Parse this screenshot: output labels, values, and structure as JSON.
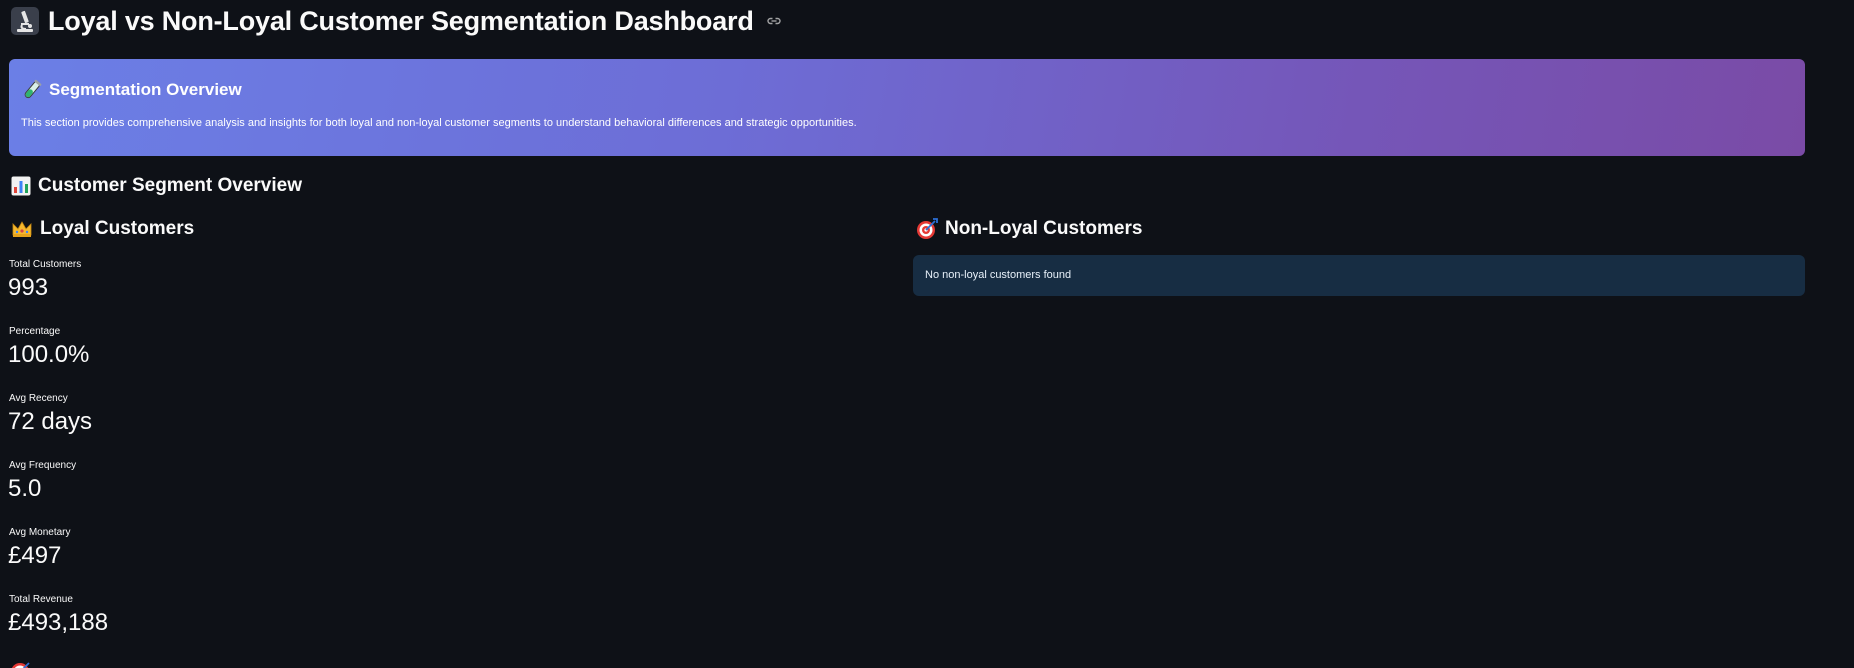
{
  "header": {
    "icon": "microscope-icon",
    "title": "Loyal vs Non-Loyal Customer Segmentation Dashboard",
    "anchor_icon": "link-icon"
  },
  "banner": {
    "icon": "test-tube-icon",
    "title": "Segmentation Overview",
    "text": "This section provides comprehensive analysis and insights for both loyal and non-loyal customer segments to understand behavioral differences and strategic opportunities.",
    "gradient_start": "#6b7fe6",
    "gradient_end": "#7a4ba6"
  },
  "overview": {
    "icon": "bar-chart-icon",
    "title": "Customer Segment Overview"
  },
  "loyal": {
    "icon": "crown-icon",
    "title": "Loyal Customers",
    "metrics": [
      {
        "label": "Total Customers",
        "value": "993"
      },
      {
        "label": "Percentage",
        "value": "100.0%"
      },
      {
        "label": "Avg Recency",
        "value": "72 days"
      },
      {
        "label": "Avg Frequency",
        "value": "5.0"
      },
      {
        "label": "Avg Monetary",
        "value": "£497"
      },
      {
        "label": "Total Revenue",
        "value": "£493,188"
      }
    ]
  },
  "non_loyal": {
    "icon": "target-icon",
    "title": "Non-Loyal Customers",
    "info_message": "No non-loyal customers found",
    "info_bg": "#172d43"
  },
  "next_section": {
    "icon": "target-icon"
  },
  "colors": {
    "background": "#0e1117",
    "text": "#fafafa"
  }
}
